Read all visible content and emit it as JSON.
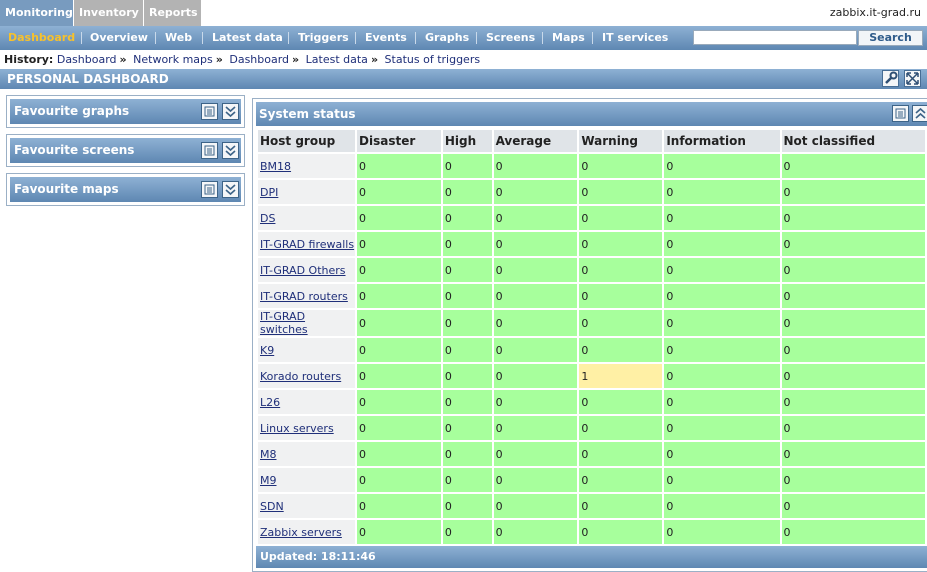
{
  "top_tabs": [
    {
      "label": "Monitoring",
      "active": true
    },
    {
      "label": "Inventory",
      "active": false
    },
    {
      "label": "Reports",
      "active": false
    }
  ],
  "site_name": "zabbix.it-grad.ru",
  "menu": [
    {
      "label": "Dashboard",
      "active": true
    },
    {
      "label": "Overview"
    },
    {
      "label": "Web"
    },
    {
      "label": "Latest data"
    },
    {
      "label": "Triggers"
    },
    {
      "label": "Events"
    },
    {
      "label": "Graphs"
    },
    {
      "label": "Screens"
    },
    {
      "label": "Maps"
    },
    {
      "label": "IT services"
    }
  ],
  "search": {
    "value": "",
    "button_label": "Search"
  },
  "history": {
    "label": "History:",
    "items": [
      "Dashboard",
      "Network maps",
      "Dashboard",
      "Latest data",
      "Status of triggers"
    ]
  },
  "page_title": "PERSONAL DASHBOARD",
  "favourites": [
    {
      "title": "Favourite graphs"
    },
    {
      "title": "Favourite screens"
    },
    {
      "title": "Favourite maps"
    }
  ],
  "system_status": {
    "title": "System status",
    "columns": [
      "Host group",
      "Disaster",
      "High",
      "Average",
      "Warning",
      "Information",
      "Not classified"
    ],
    "rows": [
      {
        "group": "BM18",
        "values": [
          "0",
          "0",
          "0",
          "0",
          "0",
          "0"
        ]
      },
      {
        "group": "DPI",
        "values": [
          "0",
          "0",
          "0",
          "0",
          "0",
          "0"
        ]
      },
      {
        "group": "DS",
        "values": [
          "0",
          "0",
          "0",
          "0",
          "0",
          "0"
        ]
      },
      {
        "group": "IT-GRAD firewalls",
        "values": [
          "0",
          "0",
          "0",
          "0",
          "0",
          "0"
        ]
      },
      {
        "group": "IT-GRAD Others",
        "values": [
          "0",
          "0",
          "0",
          "0",
          "0",
          "0"
        ]
      },
      {
        "group": "IT-GRAD routers",
        "values": [
          "0",
          "0",
          "0",
          "0",
          "0",
          "0"
        ]
      },
      {
        "group": "IT-GRAD switches",
        "values": [
          "0",
          "0",
          "0",
          "0",
          "0",
          "0"
        ]
      },
      {
        "group": "K9",
        "values": [
          "0",
          "0",
          "0",
          "0",
          "0",
          "0"
        ]
      },
      {
        "group": "Korado routers",
        "values": [
          "0",
          "0",
          "0",
          "1",
          "0",
          "0"
        ]
      },
      {
        "group": "L26",
        "values": [
          "0",
          "0",
          "0",
          "0",
          "0",
          "0"
        ]
      },
      {
        "group": "Linux servers",
        "values": [
          "0",
          "0",
          "0",
          "0",
          "0",
          "0"
        ]
      },
      {
        "group": "M8",
        "values": [
          "0",
          "0",
          "0",
          "0",
          "0",
          "0"
        ]
      },
      {
        "group": "M9",
        "values": [
          "0",
          "0",
          "0",
          "0",
          "0",
          "0"
        ]
      },
      {
        "group": "SDN",
        "values": [
          "0",
          "0",
          "0",
          "0",
          "0",
          "0"
        ]
      },
      {
        "group": "Zabbix servers",
        "values": [
          "0",
          "0",
          "0",
          "0",
          "0",
          "0"
        ]
      }
    ],
    "updated": "Updated: 18:11:46"
  },
  "colors": {
    "ok": "#a7ff9c",
    "warning": "#fff0a5",
    "header_blue": "#789bbf",
    "active_menu": "#f7c12c"
  }
}
